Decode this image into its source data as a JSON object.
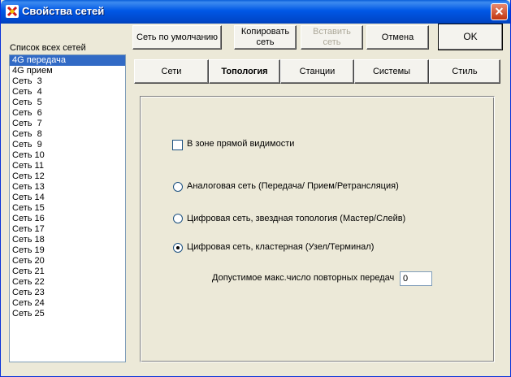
{
  "window": {
    "title": "Свойства сетей"
  },
  "list": {
    "label": "Список всех сетей",
    "items": [
      "4G передача",
      "4G прием",
      "Сеть  3",
      "Сеть  4",
      "Сеть  5",
      "Сеть  6",
      "Сеть  7",
      "Сеть  8",
      "Сеть  9",
      "Сеть 10",
      "Сеть 11",
      "Сеть 12",
      "Сеть 13",
      "Сеть 14",
      "Сеть 15",
      "Сеть 16",
      "Сеть 17",
      "Сеть 18",
      "Сеть 19",
      "Сеть 20",
      "Сеть 21",
      "Сеть 22",
      "Сеть 23",
      "Сеть 24",
      "Сеть 25"
    ],
    "selected": "4G передача"
  },
  "toolbar": {
    "default_label": "Сеть по умолчанию",
    "copy_line1": "Копировать",
    "copy_line2": "сеть",
    "paste_line1": "Вставить",
    "paste_line2": "сеть",
    "cancel_label": "Отмена",
    "ok_label": "OK"
  },
  "tabs": [
    "Сети",
    "Топология",
    "Станции",
    "Системы",
    "Стиль"
  ],
  "active_tab": "Топология",
  "topology": {
    "line_of_sight_label": "В зоне прямой видимости",
    "line_of_sight_checked": false,
    "options": [
      {
        "label": "Аналоговая сеть (Передача/ Прием/Ретрансляция)",
        "checked": false
      },
      {
        "label": "Цифровая сеть, звездная топология (Мастер/Слейв)",
        "checked": false
      },
      {
        "label": "Цифровая сеть, кластерная (Узел/Терминал)",
        "checked": true
      }
    ],
    "retries_label": "Допустимое макс.число повторных передач",
    "retries_value": "0"
  }
}
